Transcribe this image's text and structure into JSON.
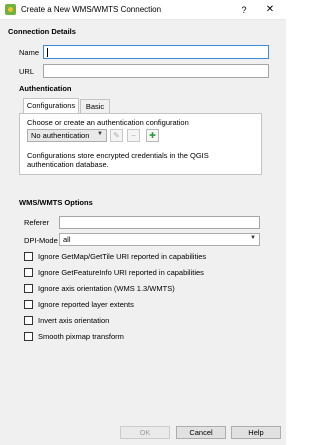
{
  "window": {
    "title": "Create a New WMS/WMTS Connection",
    "help_glyph": "?",
    "close_glyph": "✕"
  },
  "connection_details": {
    "heading": "Connection Details",
    "name_label": "Name",
    "name_value": "",
    "url_label": "URL",
    "url_value": ""
  },
  "authentication": {
    "heading": "Authentication",
    "tabs": [
      {
        "label": "Configurations",
        "active": true
      },
      {
        "label": "Basic",
        "active": false
      }
    ],
    "choose_label": "Choose or create an authentication configuration",
    "config_select": "No authentication",
    "info_text": "Configurations store encrypted credentials in the QGIS authentication database."
  },
  "wms_options": {
    "heading": "WMS/WMTS Options",
    "referer_label": "Referer",
    "referer_value": "",
    "dpi_label": "DPI-Mode",
    "dpi_value": "all",
    "checkboxes": [
      {
        "label": "Ignore GetMap/GetTile URI reported in capabilities",
        "checked": false
      },
      {
        "label": "Ignore GetFeatureInfo URI reported in capabilities",
        "checked": false
      },
      {
        "label": "Ignore axis orientation (WMS 1.3/WMTS)",
        "checked": false
      },
      {
        "label": "Ignore reported layer extents",
        "checked": false
      },
      {
        "label": "Invert axis orientation",
        "checked": false
      },
      {
        "label": "Smooth pixmap transform",
        "checked": false
      }
    ]
  },
  "buttons": {
    "ok": "OK",
    "cancel": "Cancel",
    "help": "Help"
  },
  "colors": {
    "focus_border": "#3b8bd9",
    "dialog_bg": "#f0f0f0",
    "add_icon": "#2c9a3c"
  }
}
